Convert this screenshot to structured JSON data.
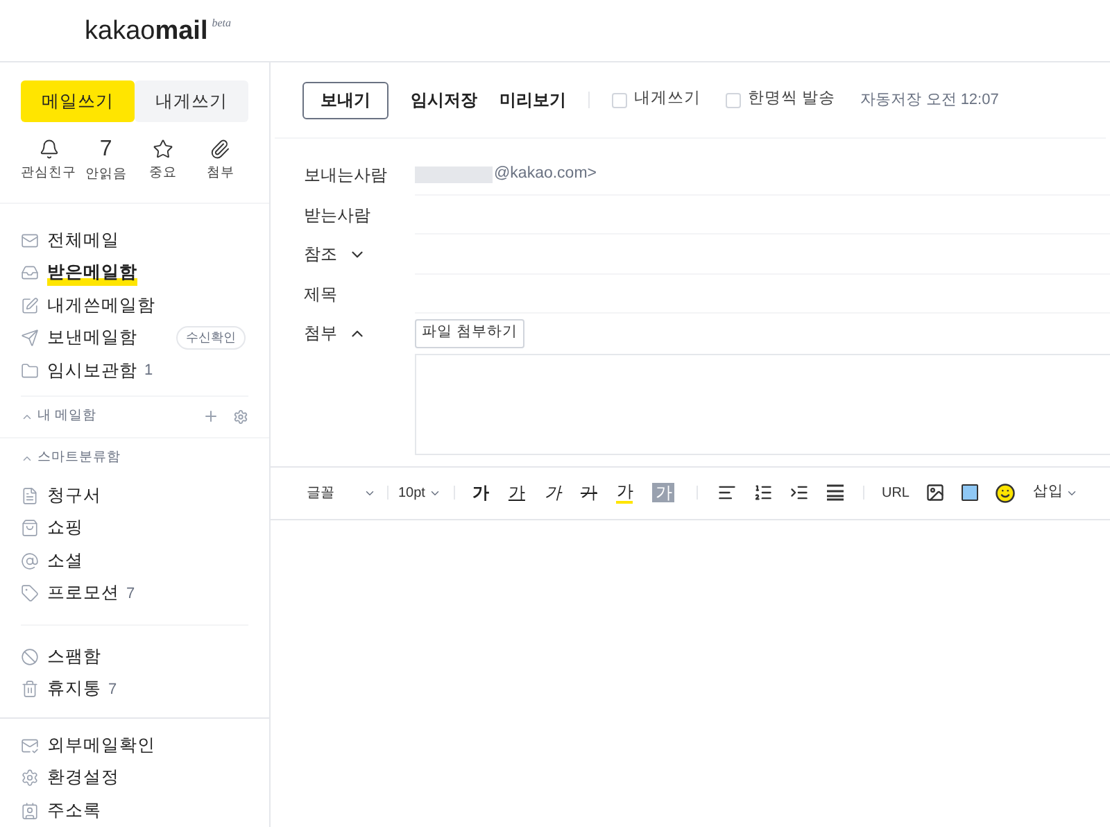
{
  "logo": {
    "brand": "kakao",
    "product": "mail",
    "tag": "beta"
  },
  "compose_buttons": [
    {
      "label": "메일쓰기",
      "selected": true
    },
    {
      "label": "내게쓰기",
      "selected": false
    }
  ],
  "quick_links": [
    {
      "kind": "icon",
      "label": "관심친구"
    },
    {
      "kind": "count",
      "count": "7",
      "label": "안읽음"
    },
    {
      "kind": "icon",
      "label": "중요"
    },
    {
      "kind": "icon",
      "label": "첨부"
    }
  ],
  "mailboxes": [
    {
      "label": "전체메일",
      "selected": false
    },
    {
      "label": "받은메일함",
      "selected": true
    },
    {
      "label": "내게쓴메일함",
      "selected": false
    },
    {
      "label": "보낸메일함",
      "selected": false,
      "badge": "수신확인"
    },
    {
      "label": "임시보관함",
      "selected": false,
      "count": "1"
    }
  ],
  "my_mailbox": {
    "title": "내 메일함"
  },
  "smart_box": {
    "title": "스마트분류함",
    "items": [
      {
        "label": "청구서"
      },
      {
        "label": "쇼핑"
      },
      {
        "label": "소셜"
      },
      {
        "label": "프로모션",
        "count": "7"
      }
    ]
  },
  "other_boxes": [
    {
      "label": "스팸함"
    },
    {
      "label": "휴지통",
      "count": "7"
    }
  ],
  "tools": [
    {
      "label": "외부메일확인"
    },
    {
      "label": "환경설정"
    },
    {
      "label": "주소록"
    }
  ],
  "toolbar": {
    "buttons": [
      {
        "label": "보내기",
        "kind": "primary"
      },
      {
        "label": "임시저장",
        "kind": "plain"
      },
      {
        "label": "미리보기",
        "kind": "plain"
      }
    ],
    "options": [
      {
        "label": "내게쓰기",
        "checked": false
      },
      {
        "label": "한명씩 발송",
        "checked": false
      }
    ],
    "autosave": "자동저장 오전 12:07"
  },
  "fields": [
    {
      "label": "보내는사람",
      "value": "@kakao.com>",
      "redacted": true
    },
    {
      "label": "받는사람"
    },
    {
      "label": "참조",
      "expanded": false
    },
    {
      "label": "제목"
    },
    {
      "label": "첨부",
      "expanded": true
    }
  ],
  "attach_button": "파일 첨부하기",
  "editor_toolbar": {
    "font": "글꼴",
    "size": "10pt",
    "formats": [
      {
        "kind": "bold",
        "label": "가"
      },
      {
        "kind": "underline",
        "label": "가"
      },
      {
        "kind": "italic",
        "label": "가"
      },
      {
        "kind": "strike",
        "label": "가"
      },
      {
        "kind": "highlight",
        "label": "가"
      },
      {
        "kind": "background",
        "label": "가"
      }
    ],
    "link": "URL",
    "insert": "삽입"
  }
}
